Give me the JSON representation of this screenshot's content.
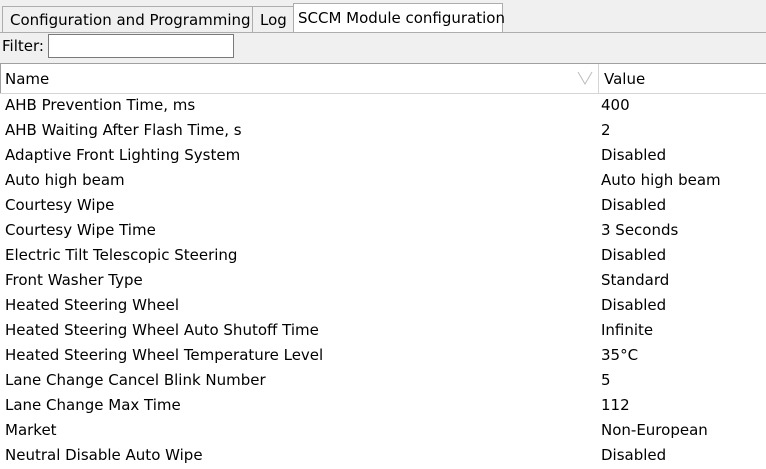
{
  "tabs": [
    {
      "label": "Configuration and Programming"
    },
    {
      "label": "Log"
    },
    {
      "label": "SCCM Module configuration"
    }
  ],
  "filter": {
    "label": "Filter:",
    "value": ""
  },
  "table": {
    "columns": {
      "name": "Name",
      "value": "Value"
    },
    "rows": [
      {
        "name": "AHB Prevention Time, ms",
        "value": "400"
      },
      {
        "name": "AHB Waiting After Flash Time, s",
        "value": "2"
      },
      {
        "name": "Adaptive Front Lighting System",
        "value": "Disabled"
      },
      {
        "name": "Auto high beam",
        "value": "Auto high beam"
      },
      {
        "name": "Courtesy Wipe",
        "value": "Disabled"
      },
      {
        "name": "Courtesy Wipe Time",
        "value": "3 Seconds"
      },
      {
        "name": "Electric Tilt Telescopic Steering",
        "value": "Disabled"
      },
      {
        "name": "Front Washer Type",
        "value": "Standard"
      },
      {
        "name": "Heated Steering Wheel",
        "value": "Disabled"
      },
      {
        "name": "Heated Steering Wheel Auto Shutoff Time",
        "value": "Infinite"
      },
      {
        "name": "Heated Steering Wheel Temperature Level",
        "value": "35°C"
      },
      {
        "name": "Lane Change Cancel Blink Number",
        "value": "5"
      },
      {
        "name": "Lane Change Max Time",
        "value": "112"
      },
      {
        "name": "Market",
        "value": "Non-European"
      },
      {
        "name": "Neutral Disable Auto Wipe",
        "value": "Disabled"
      }
    ]
  }
}
